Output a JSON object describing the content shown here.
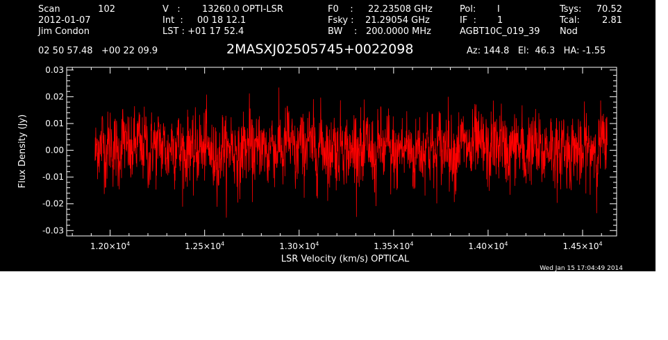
{
  "header": {
    "scan_label": "Scan",
    "scan_number": "102",
    "date": "2012-01-07",
    "observer": "Jim Condon",
    "velocity_label": "V   :",
    "velocity_value": "13260.0 OPTI-LSR",
    "int_label": "Int  :",
    "int_value": "00 18 12.1",
    "lst_label": "LST : +01 17 52.4",
    "f0_label": "F0    :",
    "f0_value": "22.23508 GHz",
    "fsky_label": "Fsky :",
    "fsky_value": "21.29054 GHz",
    "bw_label": "BW    :",
    "bw_value": "200.0000 MHz",
    "pol_label": "Pol:",
    "pol_value": "I",
    "if_label": "IF  :",
    "if_value": "1",
    "project": "AGBT10C_019_39",
    "tsys_label": "Tsys:",
    "tsys_value": "70.52",
    "tcal_label": "Tcal:",
    "tcal_value": "2.81",
    "mode": "Nod",
    "ra_dec": "02 50 57.48   +00 22 09.9",
    "source": "2MASXJ02505745+0022098",
    "az_el_ha": "Az: 144.8   El:  46.3   HA: -1.55"
  },
  "timestamp": "Wed Jan 15 17:04:49 2014",
  "colors": {
    "background": "#000000",
    "axes": "#ffffff",
    "series": "#ff0000"
  },
  "chart_data": {
    "type": "line",
    "xlabel": "LSR Velocity (km/s) OPTICAL",
    "ylabel": "Flux Density (Jy)",
    "xlim": [
      11770,
      14680
    ],
    "ylim": [
      -0.032,
      0.031
    ],
    "x_ticks": [
      {
        "value": 12000,
        "mantissa": "1.20",
        "exp": "4"
      },
      {
        "value": 12500,
        "mantissa": "1.25",
        "exp": "4"
      },
      {
        "value": 13000,
        "mantissa": "1.30",
        "exp": "4"
      },
      {
        "value": 13500,
        "mantissa": "1.35",
        "exp": "4"
      },
      {
        "value": 14000,
        "mantissa": "1.40",
        "exp": "4"
      },
      {
        "value": 14500,
        "mantissa": "1.45",
        "exp": "4"
      }
    ],
    "x_minor_step": 100,
    "y_ticks": [
      {
        "value": 0.03,
        "label": "0.03"
      },
      {
        "value": 0.02,
        "label": "0.02"
      },
      {
        "value": 0.01,
        "label": "0.01"
      },
      {
        "value": 0.0,
        "label": "0.00"
      },
      {
        "value": -0.01,
        "label": "-0.01"
      },
      {
        "value": -0.02,
        "label": "-0.02"
      },
      {
        "value": -0.03,
        "label": "-0.03"
      }
    ],
    "y_minor_step": 0.002,
    "grid": false,
    "series": [
      {
        "x_start": 11920,
        "x_end": 14630,
        "n_points": 2048,
        "noise_rms": 0.0065,
        "values": [
          -0.0055,
          0.0075,
          -0.0012,
          0.015,
          -0.008,
          0.003,
          0.011,
          -0.0035,
          0.006,
          -0.012,
          0.002,
          0.0175,
          -0.001,
          0.0045,
          -0.015,
          0.0085,
          0.0,
          0.0125,
          -0.0065,
          0.003,
          0.0095,
          -0.018,
          0.004,
          0.006,
          -0.004,
          0.0145,
          -0.0025,
          0.007,
          -0.011,
          0.0015,
          0.01,
          -0.003,
          0.0185,
          -0.006,
          0.005,
          -0.0095,
          0.0025,
          0.013,
          -0.0145,
          0.0055,
          0.0005,
          0.009,
          -0.005,
          0.016,
          -0.0015,
          0.0035,
          -0.0125,
          0.008,
          -0.02,
          0.0045,
          0.0115,
          -0.007,
          0.002,
          0.014,
          -0.0035,
          0.0065,
          -0.016,
          0.001,
          0.0105,
          -0.002,
          0.019,
          -0.0085,
          0.004,
          -0.0045,
          0.012,
          -0.001,
          0.0075,
          -0.0135,
          0.003,
          0.0165,
          -0.0055,
          0.0015,
          0.0095,
          -0.0105,
          0.005,
          0.0205,
          -0.0025,
          0.006,
          -0.019,
          0.002,
          0.011,
          -0.0065,
          0.0035,
          0.0155,
          -0.004,
          0.0085,
          -0.0115,
          0.0005,
          0.0135,
          -0.003,
          0.007,
          -0.017,
          0.0045,
          0.01,
          -0.0075,
          0.0025,
          0.018,
          -0.005,
          0.0055,
          -0.01,
          0.001,
          0.0125,
          -0.002,
          0.008,
          -0.0145,
          0.004,
          0.015,
          -0.006,
          0.003,
          -0.021,
          0.0065,
          0.0115,
          -0.0035,
          0.002,
          0.017,
          -0.0085,
          0.005,
          -0.012,
          0.0015,
          0.0095,
          -0.0045,
          0.014,
          -0.001,
          0.006,
          -0.018,
          0.0035,
          0.0105,
          -0.007,
          0.0025,
          0.016,
          -0.003,
          0.0075,
          -0.013,
          0.0,
          0.012,
          -0.0055,
          0.0045,
          0.0195,
          -0.009,
          0.003,
          -0.0155,
          0.007,
          0.001,
          0.013,
          -0.004,
          0.0055,
          -0.01,
          0.002,
          0.0145,
          -0.0065,
          0.0085,
          -0.0025,
          0.0035,
          -0.0165,
          0.006,
          0.011,
          -0.0015,
          0.005,
          0.0175,
          -0.008,
          0.0025,
          -0.0125,
          0.0065,
          0.0,
          0.0135,
          -0.0045,
          0.009,
          -0.0185,
          0.0015,
          0.01,
          -0.0035,
          0.0155,
          -0.006,
          0.004,
          -0.011,
          0.008,
          0.002,
          0.0125,
          -0.002,
          0.0055,
          -0.014,
          0.003,
          0.0185,
          -0.0075,
          0.0045,
          -0.005,
          0.0115,
          -0.001,
          0.007,
          -0.016,
          0.0035,
          0.014,
          -0.004,
          0.0015,
          0.0095,
          -0.0095,
          0.005,
          0.02,
          -0.003,
          0.006
        ]
      }
    ]
  }
}
